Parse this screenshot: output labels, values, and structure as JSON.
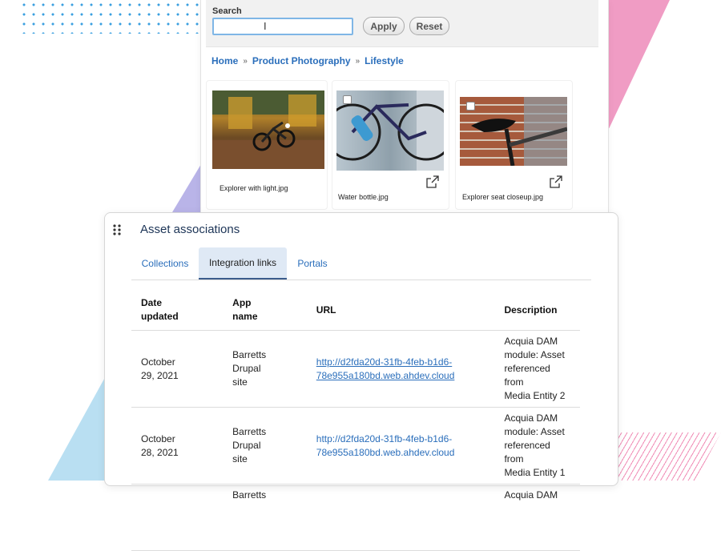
{
  "search": {
    "label": "Search",
    "value": "",
    "apply_label": "Apply",
    "reset_label": "Reset"
  },
  "breadcrumb": [
    "Home",
    "Product Photography",
    "Lifestyle"
  ],
  "breadcrumb_separator": "»",
  "assets": [
    {
      "name": "Explorer with light.jpg",
      "checkbox": false,
      "external_link": false
    },
    {
      "name": "Water bottle.jpg",
      "checkbox": true,
      "external_link": true
    },
    {
      "name": "Explorer seat closeup.jpg",
      "checkbox": true,
      "external_link": true
    }
  ],
  "associations": {
    "title": "Asset associations",
    "tabs": [
      {
        "label": "Collections",
        "active": false
      },
      {
        "label": "Integration links",
        "active": true
      },
      {
        "label": "Portals",
        "active": false
      }
    ],
    "columns": [
      "Date\nupdated",
      "App\nname",
      "URL",
      "Description"
    ],
    "rows": [
      {
        "date": "October\n29, 2021",
        "app": "Barretts\nDrupal\nsite",
        "url": "http://d2fda20d-31fb-4feb-b1d6-\n78e955a180bd.web.ahdev.cloud",
        "description": "Acquia DAM\nmodule: Asset\nreferenced from\nMedia Entity 2"
      },
      {
        "date": "October\n28, 2021",
        "app": "Barretts\nDrupal\nsite",
        "url": "http://d2fda20d-31fb-4feb-b1d6-\n78e955a180bd.web.ahdev.cloud",
        "description": "Acquia DAM\nmodule: Asset\nreferenced from\nMedia Entity 1"
      },
      {
        "date": "",
        "app": "Barretts",
        "url": "",
        "description": "Acquia DAM"
      }
    ]
  },
  "colors": {
    "link": "#2a6ebb",
    "active_tab_bg": "#dfe9f5",
    "title": "#1d3557",
    "deco_pink": "#f0a6c8",
    "deco_blue": "#b9dff2",
    "deco_purple": "#b9b4e8"
  },
  "icons": [
    "text-cursor-icon",
    "external-link-icon",
    "drag-handle-icon"
  ]
}
